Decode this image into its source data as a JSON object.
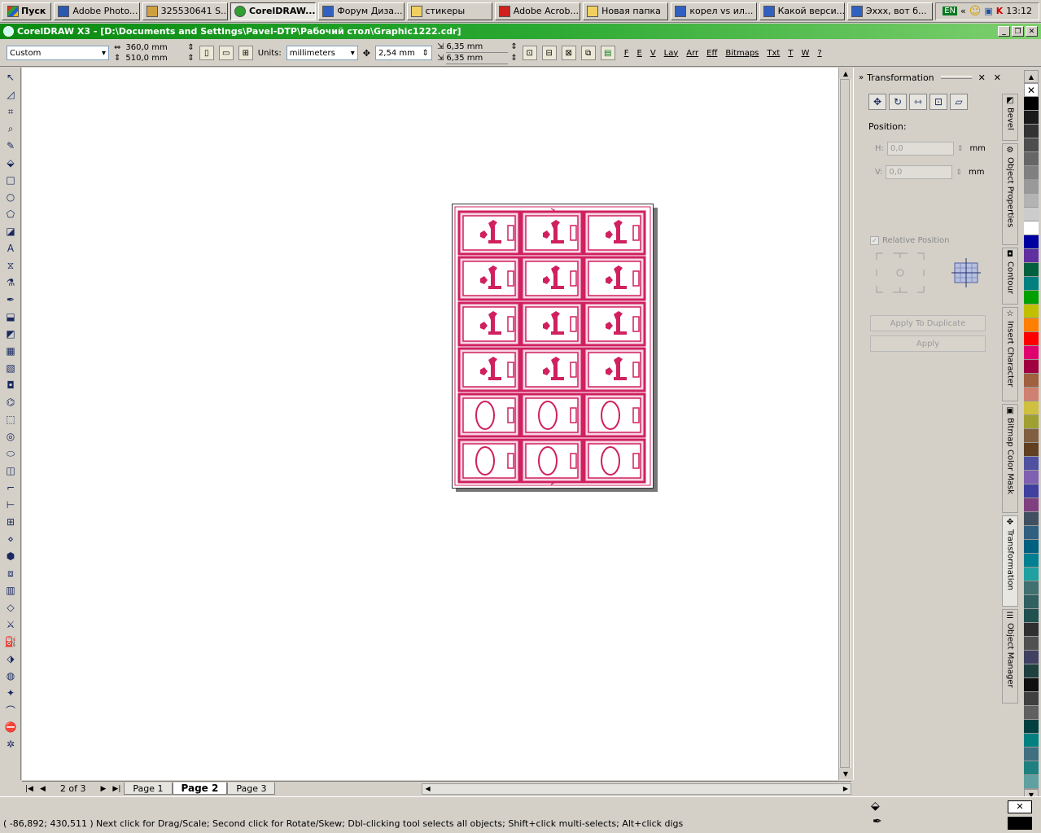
{
  "taskbar": {
    "start_label": "Пуск",
    "tasks": [
      {
        "label": "Adobe Photo..."
      },
      {
        "label": "325530641 S..."
      },
      {
        "label": "CorelDRAW..."
      },
      {
        "label": "Форум Диза..."
      },
      {
        "label": "стикеры"
      },
      {
        "label": "Adobe Acrob..."
      },
      {
        "label": "Новая папка"
      },
      {
        "label": "корел vs ил..."
      },
      {
        "label": "Какой верси..."
      },
      {
        "label": "Эххх, вот б..."
      }
    ],
    "lang": "EN",
    "chevron": "«",
    "clock": "13:12"
  },
  "window": {
    "title": "CorelDRAW X3 - [D:\\Documents and Settings\\Pavel-DTP\\Рабочий стол\\Graphic1222.cdr]"
  },
  "propbar": {
    "page_size": "Custom",
    "width": "360,0 mm",
    "height": "510,0 mm",
    "units_label": "Units:",
    "units_value": "millimeters",
    "nudge": "2,54 mm",
    "dup_x": "6,35 mm",
    "dup_y": "6,35 mm",
    "menus": [
      "F",
      "E",
      "V",
      "Lay",
      "Arr",
      "Eff",
      "Bitmaps",
      "Txt",
      "T",
      "W",
      "?"
    ]
  },
  "docker": {
    "title": "Transformation",
    "position_label": "Position:",
    "h_label": "H:",
    "h_value": "0,0",
    "v_label": "V:",
    "v_value": "0,0",
    "unit": "mm",
    "relative_label": "Relative Position",
    "apply_dup_label": "Apply To Duplicate",
    "apply_label": "Apply"
  },
  "docker_tabs": [
    {
      "label": "Bevel"
    },
    {
      "label": "Object Properties"
    },
    {
      "label": "Contour"
    },
    {
      "label": "Insert Character"
    },
    {
      "label": "Bitmap Color Mask"
    },
    {
      "label": "Transformation"
    },
    {
      "label": "Object Manager"
    }
  ],
  "pages": {
    "counter": "2 of 3",
    "tabs": [
      "Page 1",
      "Page 2",
      "Page 3"
    ],
    "active": "Page 2"
  },
  "status": {
    "coords": "( -86,892; 430,511 )",
    "message": "Next click for Drag/Scale; Second click for Rotate/Skew; Dbl-clicking tool selects all objects; Shift+click multi-selects; Alt+click digs"
  },
  "document": {
    "rows": 6,
    "cols": 3,
    "shaped_rows": 4,
    "accent": "#d02060"
  },
  "palette": [
    "#000000",
    "#1a1a1a",
    "#333333",
    "#4d4d4d",
    "#666666",
    "#808080",
    "#999999",
    "#b3b3b3",
    "#cccccc",
    "#ffffff",
    "#0000a0",
    "#6030a0",
    "#006040",
    "#008080",
    "#00a000",
    "#c0c000",
    "#ff8000",
    "#ff0000",
    "#e00070",
    "#a00040",
    "#a06040",
    "#d08070",
    "#d0c040",
    "#a0a030",
    "#806040",
    "#604020",
    "#5050a0",
    "#8060b0",
    "#4040a0",
    "#804080",
    "#405060",
    "#306080",
    "#006080",
    "#008090",
    "#20a0a0",
    "#407070",
    "#306060",
    "#205050",
    "#303030",
    "#505050",
    "#404060",
    "#204040",
    "#101010",
    "#404040",
    "#606060",
    "#004040",
    "#008080",
    "#407080",
    "#208080",
    "#60a0a0"
  ]
}
